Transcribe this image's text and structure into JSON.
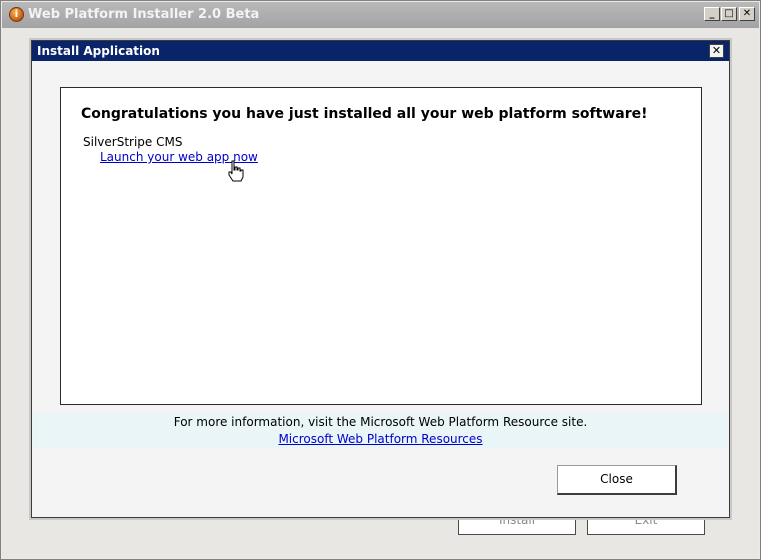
{
  "window": {
    "title": "Web Platform Installer 2.0 Beta",
    "minimize_glyph": "_",
    "maximize_glyph": "□",
    "close_glyph": "✕",
    "icon_glyph": "i"
  },
  "underlying_buttons": {
    "install_label": "Install",
    "exit_label": "Exit"
  },
  "dialog": {
    "title": "Install Application",
    "close_glyph": "✕",
    "heading": "Congratulations you have just installed all your web platform software!",
    "app_name": "SilverStripe CMS",
    "launch_link": "Launch your web app now",
    "info_text": "For more information, visit the Microsoft Web Platform Resource site.",
    "info_link": "Microsoft Web Platform Resources",
    "close_label": "Close"
  },
  "colors": {
    "dialog_titlebar": "#0a246a",
    "link": "#0000cc",
    "info_band": "#eaf5f8"
  },
  "icons": [
    "web-platform-installer-icon",
    "hand-cursor-icon"
  ]
}
